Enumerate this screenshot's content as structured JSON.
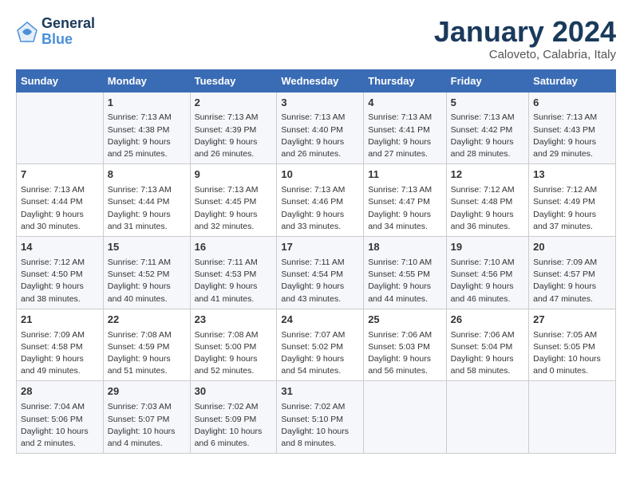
{
  "logo": {
    "line1": "General",
    "line2": "Blue"
  },
  "title": "January 2024",
  "subtitle": "Caloveto, Calabria, Italy",
  "headers": [
    "Sunday",
    "Monday",
    "Tuesday",
    "Wednesday",
    "Thursday",
    "Friday",
    "Saturday"
  ],
  "weeks": [
    [
      {
        "day": "",
        "info": ""
      },
      {
        "day": "1",
        "info": "Sunrise: 7:13 AM\nSunset: 4:38 PM\nDaylight: 9 hours\nand 25 minutes."
      },
      {
        "day": "2",
        "info": "Sunrise: 7:13 AM\nSunset: 4:39 PM\nDaylight: 9 hours\nand 26 minutes."
      },
      {
        "day": "3",
        "info": "Sunrise: 7:13 AM\nSunset: 4:40 PM\nDaylight: 9 hours\nand 26 minutes."
      },
      {
        "day": "4",
        "info": "Sunrise: 7:13 AM\nSunset: 4:41 PM\nDaylight: 9 hours\nand 27 minutes."
      },
      {
        "day": "5",
        "info": "Sunrise: 7:13 AM\nSunset: 4:42 PM\nDaylight: 9 hours\nand 28 minutes."
      },
      {
        "day": "6",
        "info": "Sunrise: 7:13 AM\nSunset: 4:43 PM\nDaylight: 9 hours\nand 29 minutes."
      }
    ],
    [
      {
        "day": "7",
        "info": "Sunrise: 7:13 AM\nSunset: 4:44 PM\nDaylight: 9 hours\nand 30 minutes."
      },
      {
        "day": "8",
        "info": "Sunrise: 7:13 AM\nSunset: 4:44 PM\nDaylight: 9 hours\nand 31 minutes."
      },
      {
        "day": "9",
        "info": "Sunrise: 7:13 AM\nSunset: 4:45 PM\nDaylight: 9 hours\nand 32 minutes."
      },
      {
        "day": "10",
        "info": "Sunrise: 7:13 AM\nSunset: 4:46 PM\nDaylight: 9 hours\nand 33 minutes."
      },
      {
        "day": "11",
        "info": "Sunrise: 7:13 AM\nSunset: 4:47 PM\nDaylight: 9 hours\nand 34 minutes."
      },
      {
        "day": "12",
        "info": "Sunrise: 7:12 AM\nSunset: 4:48 PM\nDaylight: 9 hours\nand 36 minutes."
      },
      {
        "day": "13",
        "info": "Sunrise: 7:12 AM\nSunset: 4:49 PM\nDaylight: 9 hours\nand 37 minutes."
      }
    ],
    [
      {
        "day": "14",
        "info": "Sunrise: 7:12 AM\nSunset: 4:50 PM\nDaylight: 9 hours\nand 38 minutes."
      },
      {
        "day": "15",
        "info": "Sunrise: 7:11 AM\nSunset: 4:52 PM\nDaylight: 9 hours\nand 40 minutes."
      },
      {
        "day": "16",
        "info": "Sunrise: 7:11 AM\nSunset: 4:53 PM\nDaylight: 9 hours\nand 41 minutes."
      },
      {
        "day": "17",
        "info": "Sunrise: 7:11 AM\nSunset: 4:54 PM\nDaylight: 9 hours\nand 43 minutes."
      },
      {
        "day": "18",
        "info": "Sunrise: 7:10 AM\nSunset: 4:55 PM\nDaylight: 9 hours\nand 44 minutes."
      },
      {
        "day": "19",
        "info": "Sunrise: 7:10 AM\nSunset: 4:56 PM\nDaylight: 9 hours\nand 46 minutes."
      },
      {
        "day": "20",
        "info": "Sunrise: 7:09 AM\nSunset: 4:57 PM\nDaylight: 9 hours\nand 47 minutes."
      }
    ],
    [
      {
        "day": "21",
        "info": "Sunrise: 7:09 AM\nSunset: 4:58 PM\nDaylight: 9 hours\nand 49 minutes."
      },
      {
        "day": "22",
        "info": "Sunrise: 7:08 AM\nSunset: 4:59 PM\nDaylight: 9 hours\nand 51 minutes."
      },
      {
        "day": "23",
        "info": "Sunrise: 7:08 AM\nSunset: 5:00 PM\nDaylight: 9 hours\nand 52 minutes."
      },
      {
        "day": "24",
        "info": "Sunrise: 7:07 AM\nSunset: 5:02 PM\nDaylight: 9 hours\nand 54 minutes."
      },
      {
        "day": "25",
        "info": "Sunrise: 7:06 AM\nSunset: 5:03 PM\nDaylight: 9 hours\nand 56 minutes."
      },
      {
        "day": "26",
        "info": "Sunrise: 7:06 AM\nSunset: 5:04 PM\nDaylight: 9 hours\nand 58 minutes."
      },
      {
        "day": "27",
        "info": "Sunrise: 7:05 AM\nSunset: 5:05 PM\nDaylight: 10 hours\nand 0 minutes."
      }
    ],
    [
      {
        "day": "28",
        "info": "Sunrise: 7:04 AM\nSunset: 5:06 PM\nDaylight: 10 hours\nand 2 minutes."
      },
      {
        "day": "29",
        "info": "Sunrise: 7:03 AM\nSunset: 5:07 PM\nDaylight: 10 hours\nand 4 minutes."
      },
      {
        "day": "30",
        "info": "Sunrise: 7:02 AM\nSunset: 5:09 PM\nDaylight: 10 hours\nand 6 minutes."
      },
      {
        "day": "31",
        "info": "Sunrise: 7:02 AM\nSunset: 5:10 PM\nDaylight: 10 hours\nand 8 minutes."
      },
      {
        "day": "",
        "info": ""
      },
      {
        "day": "",
        "info": ""
      },
      {
        "day": "",
        "info": ""
      }
    ]
  ]
}
